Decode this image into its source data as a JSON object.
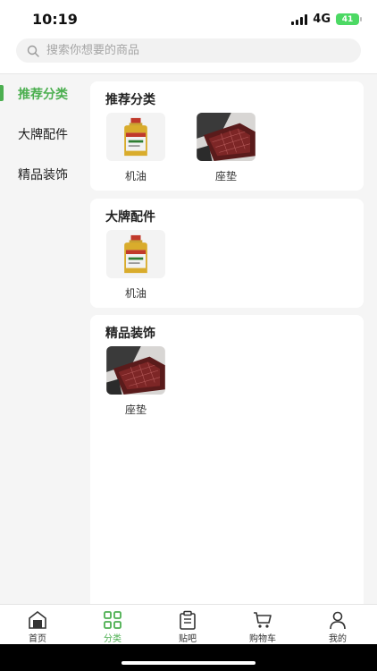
{
  "status": {
    "time": "10:19",
    "network": "4G",
    "battery": "41"
  },
  "search": {
    "placeholder": "搜索你想要的商品"
  },
  "sidebar": {
    "items": [
      {
        "label": "推荐分类"
      },
      {
        "label": "大牌配件"
      },
      {
        "label": "精品装饰"
      }
    ]
  },
  "sections": [
    {
      "title": "推荐分类",
      "products": [
        {
          "label": "机油"
        },
        {
          "label": "座垫"
        }
      ]
    },
    {
      "title": "大牌配件",
      "products": [
        {
          "label": "机油"
        }
      ]
    },
    {
      "title": "精品装饰",
      "products": [
        {
          "label": "座垫"
        }
      ]
    }
  ],
  "tabbar": {
    "items": [
      {
        "label": "首页"
      },
      {
        "label": "分类"
      },
      {
        "label": "贴吧"
      },
      {
        "label": "购物车"
      },
      {
        "label": "我的"
      }
    ]
  },
  "colors": {
    "accent": "#4caf50"
  }
}
